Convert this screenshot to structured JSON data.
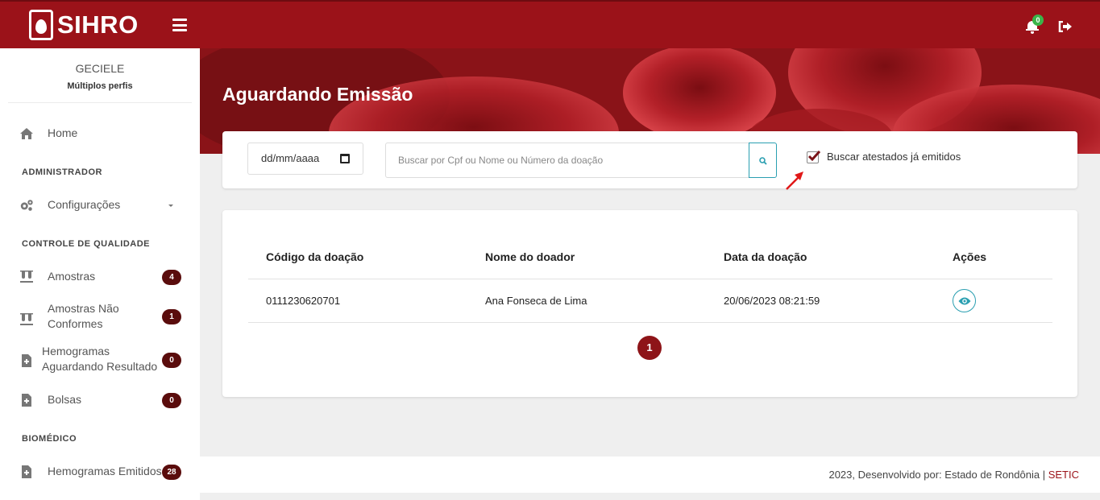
{
  "app": {
    "name": "SIHRO"
  },
  "header": {
    "notification_count": "0"
  },
  "sidebar": {
    "user_name": "GECIELE",
    "user_role": "Múltiplos perfis",
    "home": "Home",
    "section_admin": "ADMINISTRADOR",
    "config": "Configurações",
    "section_quality": "CONTROLE DE QUALIDADE",
    "items_quality": [
      {
        "label": "Amostras",
        "count": "4"
      },
      {
        "label": "Amostras Não Conformes",
        "count": "1"
      },
      {
        "label": "Hemogramas Aguardando Resultado",
        "count": "0"
      },
      {
        "label": "Bolsas",
        "count": "0"
      }
    ],
    "section_biomed": "BIOMÉDICO",
    "items_biomed": [
      {
        "label": "Hemogramas Emitidos",
        "count": "28"
      }
    ]
  },
  "page": {
    "title": "Aguardando Emissão"
  },
  "filter": {
    "date_placeholder": "dd/mm/aaaa",
    "search_placeholder": "Buscar por Cpf ou Nome ou Número da doação",
    "checkbox_label": "Buscar atestados já emitidos",
    "checkbox_checked": true
  },
  "table": {
    "headers": [
      "Código da doação",
      "Nome do doador",
      "Data da doação",
      "Ações"
    ],
    "rows": [
      {
        "code": "0111230620701",
        "name": "Ana Fonseca de Lima",
        "date": "20/06/2023 08:21:59"
      }
    ],
    "current_page": "1"
  },
  "footer": {
    "text": "2023, Desenvolvido por: Estado de Rondônia | ",
    "link": "SETIC"
  },
  "colors": {
    "brand": "#9b1219",
    "accent": "#2a9fb1",
    "badge": "#5a0c0c"
  }
}
